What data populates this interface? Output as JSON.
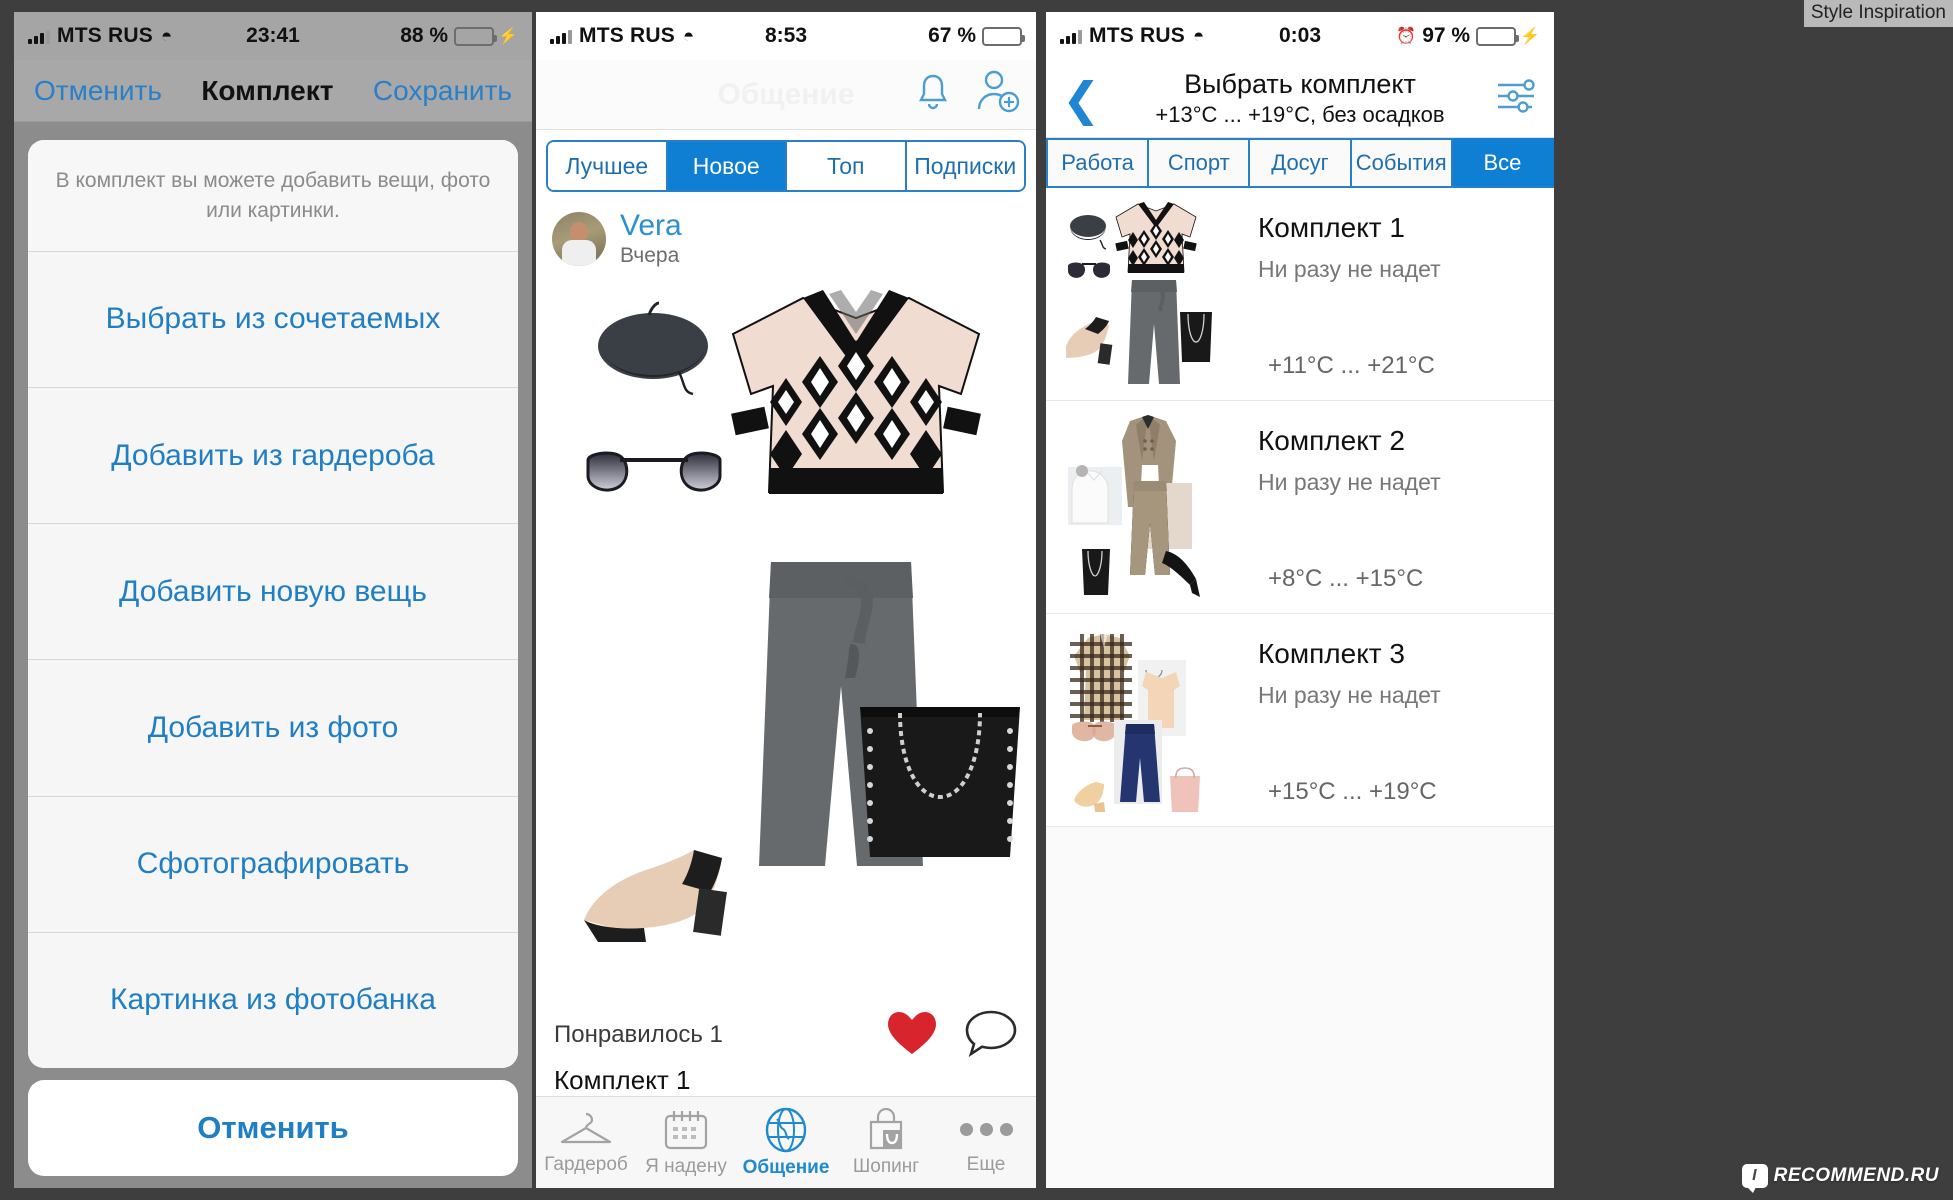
{
  "corner_label": "Style Inspiration",
  "watermark": {
    "badge": "I",
    "text": "RECOMMEND.RU"
  },
  "panel1": {
    "status": {
      "carrier": "MTS RUS",
      "wifi_icon": "wifi-icon",
      "time": "23:41",
      "battery_percent": "88 %",
      "battery_color": "#4ee07a",
      "charging_icon": "bolt-icon"
    },
    "nav": {
      "cancel": "Отменить",
      "title": "Комплект",
      "save": "Сохранить"
    },
    "sheet": {
      "message": "В комплект вы можете добавить вещи, фото или картинки.",
      "items": [
        "Выбрать из сочетаемых",
        "Добавить из гардероба",
        "Добавить новую вещь",
        "Добавить из фото",
        "Сфотографировать",
        "Картинка из фотобанка"
      ],
      "cancel": "Отменить"
    }
  },
  "panel2": {
    "status": {
      "carrier": "MTS RUS",
      "wifi_icon": "wifi-icon",
      "time": "8:53",
      "battery_percent": "67 %",
      "battery_color": "#111111"
    },
    "nav": {
      "title": "Общение",
      "bell_icon": "bell-icon",
      "add_user_icon": "add-user-icon"
    },
    "segmented": {
      "options": [
        "Лучшее",
        "Новое",
        "Топ",
        "Подписки"
      ],
      "selected": "Новое"
    },
    "post": {
      "author": "Vera",
      "time": "Вчера",
      "likes": "Понравилось 1",
      "heart_icon": "heart-icon",
      "comment_icon": "comment-icon",
      "set_name": "Комплект 1"
    },
    "tabbar": {
      "items": [
        {
          "label": "Гардероб",
          "icon": "hanger-icon"
        },
        {
          "label": "Я надену",
          "icon": "calendar-icon"
        },
        {
          "label": "Общение",
          "icon": "globe-icon"
        },
        {
          "label": "Шопинг",
          "icon": "shopping-bag-icon"
        },
        {
          "label": "Еще",
          "icon": "ellipsis-icon"
        }
      ],
      "active": "Общение"
    }
  },
  "panel3": {
    "status": {
      "carrier": "MTS RUS",
      "wifi_icon": "wifi-icon",
      "time": "0:03",
      "alarm_icon": "alarm-icon",
      "battery_percent": "97 %",
      "battery_color": "#4ee07a",
      "charging_icon": "bolt-icon"
    },
    "nav": {
      "back_icon": "chevron-left-icon",
      "title": "Выбрать комплект",
      "subtitle": "+13°C ... +19°C, без осадков",
      "filter_icon": "sliders-icon"
    },
    "segmented": {
      "options": [
        "Работа",
        "Спорт",
        "Досуг",
        "События",
        "Все"
      ],
      "selected": "Все"
    },
    "outfits": [
      {
        "title": "Комплект 1",
        "status": "Ни разу не надет",
        "temp": "+11°C ... +21°C"
      },
      {
        "title": "Комплект 2",
        "status": "Ни разу не надет",
        "temp": "+8°C ... +15°C"
      },
      {
        "title": "Комплект 3",
        "status": "Ни разу не надет",
        "temp": "+15°C ... +19°C"
      }
    ]
  }
}
